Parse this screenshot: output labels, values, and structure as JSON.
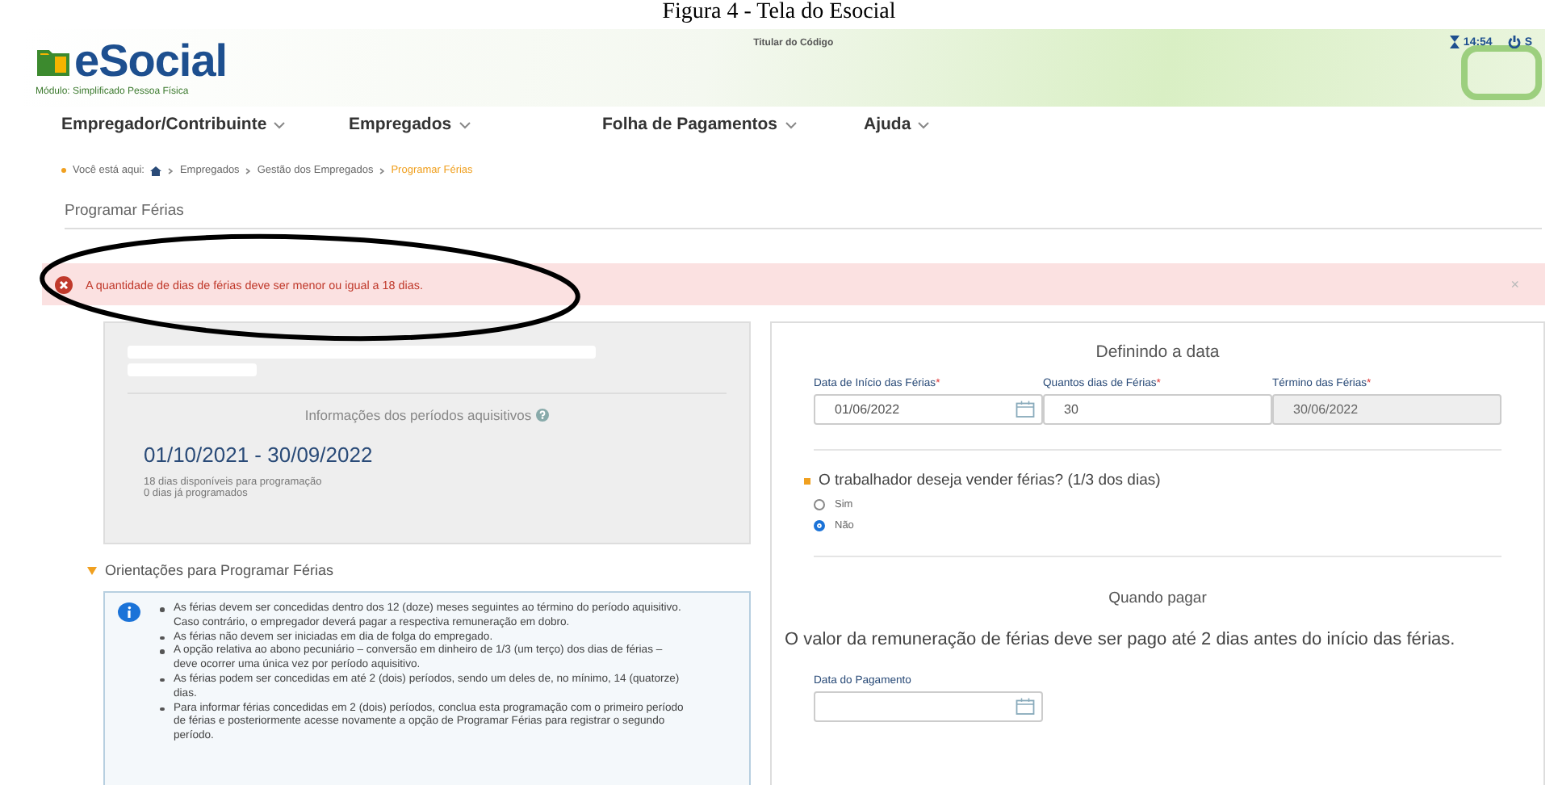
{
  "caption": "Figura 4 - Tela do Esocial",
  "header": {
    "logo": "eSocial",
    "module": "Módulo: Simplificado Pessoa Física",
    "holder_label": "Titular do Código",
    "time": "14:54",
    "exit": "S"
  },
  "nav": [
    {
      "label": "Empregador/Contribuinte"
    },
    {
      "label": "Empregados"
    },
    {
      "label": "Folha de Pagamentos"
    },
    {
      "label": "Ajuda"
    }
  ],
  "breadcrumb": {
    "prefix": "Você está aqui:",
    "items": [
      {
        "label": "Empregados",
        "current": false
      },
      {
        "label": "Gestão dos Empregados",
        "current": false
      },
      {
        "label": "Programar Férias",
        "current": true
      }
    ]
  },
  "page_title": "Programar Férias",
  "alert": {
    "message": "A quantidade de dias de férias deve ser menor ou igual a 18 dias.",
    "close": "×"
  },
  "period_card": {
    "heading": "Informações dos períodos aquisitivos",
    "period": "01/10/2021 - 30/09/2022",
    "lines": [
      "18 dias disponíveis para programação",
      "0 dias já programados"
    ]
  },
  "guidance": {
    "title": "Orientações para Programar Férias",
    "expanded": true,
    "items": [
      "As férias devem ser concedidas dentro dos 12 (doze) meses seguintes ao término do período aquisitivo. Caso contrário, o empregador deverá pagar a respectiva remuneração em dobro.",
      "As férias não devem ser iniciadas em dia de folga do empregado.",
      "A opção relativa ao abono pecuniário – conversão em dinheiro de 1/3 (um terço) dos dias de férias – deve ocorrer uma única vez por período aquisitivo.",
      "As férias podem ser concedidas em até 2 (dois) períodos, sendo um deles de, no mínimo, 14 (quatorze) dias.",
      "Para informar férias concedidas em 2 (dois) períodos, conclua esta programação com o primeiro período de férias e posteriormente acesse novamente a opção de Programar Férias para registrar o segundo período."
    ]
  },
  "date_section": {
    "title": "Definindo a data",
    "fields": [
      {
        "label": "Data de Início das Férias",
        "mark": "*",
        "value": "01/06/2022",
        "kind": "date"
      },
      {
        "label": "Quantos dias de Férias",
        "mark": "*",
        "value": "30",
        "kind": "number"
      },
      {
        "label": "Término das Férias",
        "mark": "*",
        "value": "30/06/2022",
        "kind": "readonly"
      }
    ]
  },
  "sell_question": {
    "label": "O trabalhador deseja vender férias? (1/3 dos dias)",
    "options": [
      {
        "label": "Sim",
        "selected": false
      },
      {
        "label": "Não",
        "selected": true
      }
    ]
  },
  "payment": {
    "title": "Quando pagar",
    "text": "O valor da remuneração de férias deve ser pago até 2 dias antes do início das férias.",
    "field": {
      "label": "Data do Pagamento",
      "kind": "date"
    }
  }
}
